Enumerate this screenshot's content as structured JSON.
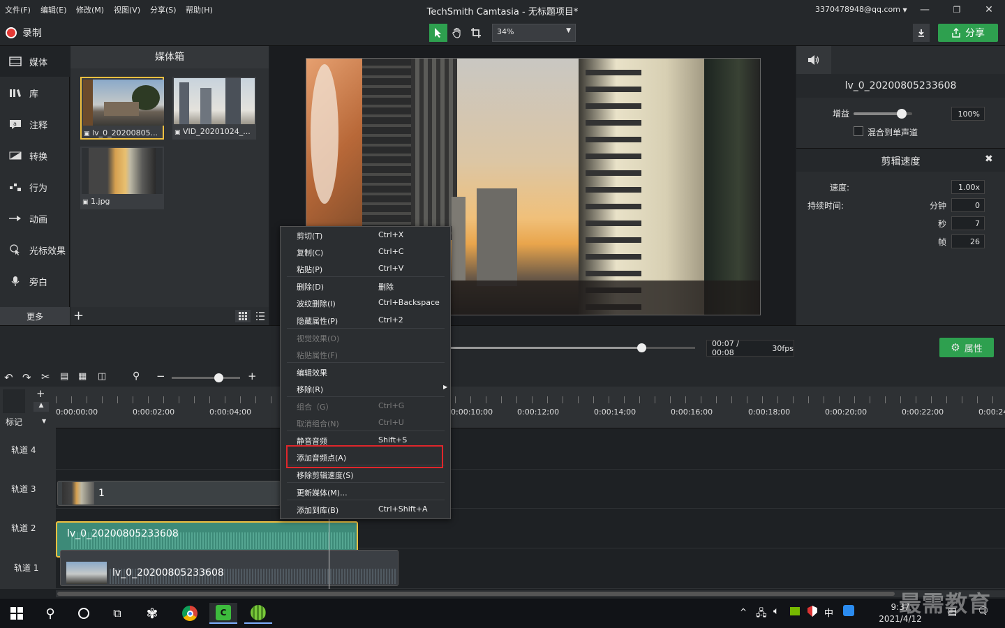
{
  "menu": [
    "文件(F)",
    "编辑(E)",
    "修改(M)",
    "视图(V)",
    "分享(S)",
    "帮助(H)"
  ],
  "app_title": "TechSmith Camtasia - 无标题项目*",
  "account": "3370478948@qq.com",
  "toolbar": {
    "record_label": "录制",
    "zoom": "34%",
    "share_label": "分享"
  },
  "leftnav": {
    "items": [
      "媒体",
      "库",
      "注释",
      "转换",
      "行为",
      "动画",
      "光标效果",
      "旁白"
    ],
    "more_label": "更多"
  },
  "bin": {
    "title": "媒体箱",
    "items": [
      "lv_0_20200805...",
      "VID_20201024_...",
      "1.jpg"
    ]
  },
  "props": {
    "clip_name": "lv_0_20200805233608",
    "gain_label": "增益",
    "gain_value": "100%",
    "gain_level": 0.82,
    "mono_label": "混合到单声道",
    "speed_section": "剪辑速度",
    "speed_label": "速度:",
    "speed_value": "1.00x",
    "duration_label": "持续时间:",
    "min_label": "分钟",
    "min_value": "0",
    "sec_label": "秒",
    "sec_value": "7",
    "frame_label": "帧",
    "frame_value": "26"
  },
  "playback": {
    "time": "00:07 / 00:08",
    "fps": "30fps",
    "properties_label": "属性"
  },
  "timeline": {
    "marker_label": "标记",
    "ticks": [
      "0:00:00;00",
      "0:00:02;00",
      "0:00:04;00",
      "0:00:10;00",
      "0:00:12;00",
      "0:00:14;00",
      "0:00:16;00",
      "0:00:18;00",
      "0:00:20;00",
      "0:00:22;00",
      "0:00:24"
    ],
    "tracks": [
      "轨道 4",
      "轨道 3",
      "轨道 2",
      "轨道 1"
    ],
    "clips": {
      "track3": "1",
      "track2": "lv_0_20200805233608",
      "track1": "lv_0_20200805233608"
    }
  },
  "context_menu": [
    {
      "label": "剪切(T)",
      "shortcut": "Ctrl+X",
      "disabled": false
    },
    {
      "label": "复制(C)",
      "shortcut": "Ctrl+C",
      "disabled": false
    },
    {
      "label": "粘贴(P)",
      "shortcut": "Ctrl+V",
      "disabled": false
    },
    {
      "label": "删除(D)",
      "shortcut": "删除",
      "disabled": false
    },
    {
      "label": "波纹删除(I)",
      "shortcut": "Ctrl+Backspace",
      "disabled": false
    },
    {
      "label": "隐藏属性(P)",
      "shortcut": "Ctrl+2",
      "disabled": false
    },
    {
      "label": "视觉效果(O)",
      "shortcut": "",
      "disabled": true
    },
    {
      "label": "粘贴属性(F)",
      "shortcut": "",
      "disabled": true
    },
    {
      "label": "编辑效果",
      "shortcut": "",
      "disabled": false
    },
    {
      "label": "移除(R)",
      "shortcut": "",
      "disabled": false
    },
    {
      "label": "组合（G）",
      "shortcut": "Ctrl+G",
      "disabled": true
    },
    {
      "label": "取消组合(N)",
      "shortcut": "Ctrl+U",
      "disabled": true
    },
    {
      "label": "静音音频",
      "shortcut": "Shift+S",
      "disabled": false
    },
    {
      "label": "添加音频点(A)",
      "shortcut": "",
      "disabled": false
    },
    {
      "label": "移除剪辑速度(S)",
      "shortcut": "",
      "disabled": false
    },
    {
      "label": "更新媒体(M)...",
      "shortcut": "",
      "disabled": false
    },
    {
      "label": "添加到库(B)",
      "shortcut": "Ctrl+Shift+A",
      "disabled": false
    }
  ],
  "taskbar": {
    "time": "9:37",
    "date": "2021/4/12",
    "ime": "中"
  },
  "watermark": "最需教育",
  "colors": {
    "accent_green": "#2ea04f",
    "highlight_red": "#e0262b",
    "selection_yellow": "#f0c040"
  }
}
